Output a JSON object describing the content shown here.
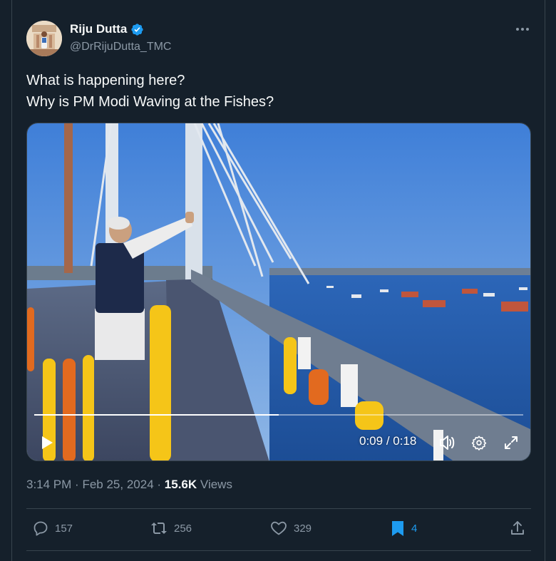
{
  "author": {
    "name": "Riju Dutta",
    "handle": "@DrRijuDutta_TMC",
    "verified": true
  },
  "tweet": {
    "lines": [
      "What is happening here?",
      "Why is PM Modi Waving at the Fishes?"
    ]
  },
  "video": {
    "current_time": "0:09",
    "duration": "0:18",
    "time_separator": "/",
    "progress": 0.5
  },
  "meta": {
    "time": "3:14 PM",
    "separator": "·",
    "date": "Feb 25, 2024",
    "views_count": "15.6K",
    "views_label": "Views"
  },
  "actions": {
    "replies": "157",
    "reposts": "256",
    "likes": "329",
    "bookmarks": "4"
  },
  "colors": {
    "background": "#15202b",
    "border": "#38444d",
    "secondary_text": "#8b98a5",
    "accent": "#1d9bf0"
  },
  "icons": [
    "verified-badge-icon",
    "more-icon",
    "play-icon",
    "volume-icon",
    "settings-icon",
    "fullscreen-icon",
    "reply-icon",
    "repost-icon",
    "like-icon",
    "bookmark-icon",
    "share-icon"
  ]
}
